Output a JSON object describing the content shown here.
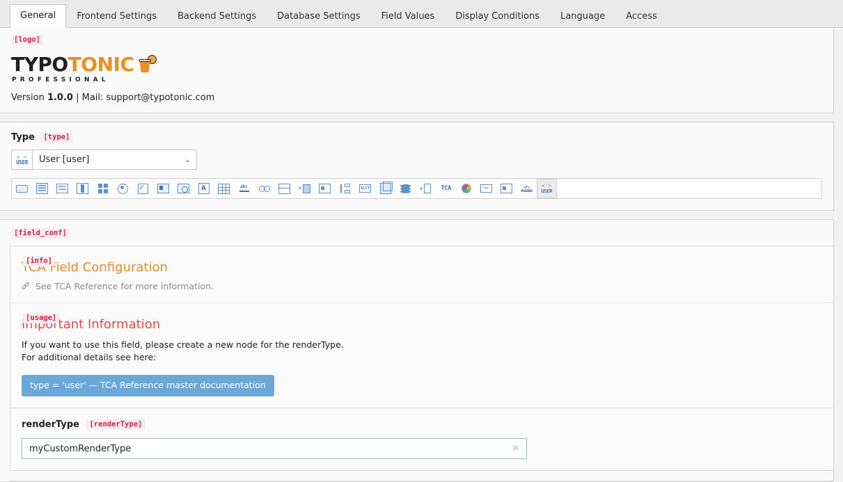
{
  "tabs": [
    {
      "label": "General",
      "active": true
    },
    {
      "label": "Frontend Settings",
      "active": false
    },
    {
      "label": "Backend Settings",
      "active": false
    },
    {
      "label": "Database Settings",
      "active": false
    },
    {
      "label": "Field Values",
      "active": false
    },
    {
      "label": "Display Conditions",
      "active": false
    },
    {
      "label": "Language",
      "active": false
    },
    {
      "label": "Access",
      "active": false
    }
  ],
  "logo_panel": {
    "badge": "[logo]",
    "logo_text_primary": "TYPO",
    "logo_text_accent": "TONIC",
    "logo_subtitle": "PROFESSIONAL",
    "version_prefix": "Version ",
    "version_number": "1.0.0",
    "version_suffix": " | Mail: support@typotonic.com"
  },
  "type_panel": {
    "label": "Type",
    "badge": "[type]",
    "select_value": "User [user]",
    "select_icon_top": "< >",
    "select_icon_bottom": "USER",
    "chevron": "⌄",
    "toolbar_icons": [
      {
        "name": "input-icon",
        "shape": "sh-box",
        "text": "",
        "selected": false
      },
      {
        "name": "text-icon",
        "shape": "sh-frame",
        "text": "",
        "selected": false
      },
      {
        "name": "textarea-icon",
        "shape": "sh-rows",
        "text": "",
        "selected": false
      },
      {
        "name": "split-view-icon",
        "shape": "sh-split",
        "text": "",
        "selected": false
      },
      {
        "name": "grid-icon",
        "shape": "sh-grid4",
        "text": "",
        "selected": false
      },
      {
        "name": "radio-icon",
        "shape": "sh-radio",
        "text": "",
        "selected": false
      },
      {
        "name": "checkbox-icon",
        "shape": "sh-check",
        "text": "",
        "selected": false
      },
      {
        "name": "image-text-icon",
        "shape": "sh-imgtxt",
        "text": "",
        "selected": false
      },
      {
        "name": "datetime-icon",
        "shape": "sh-imgclock",
        "text": "",
        "selected": false
      },
      {
        "name": "letter-a-icon",
        "shape": "sh-letter",
        "text": "A",
        "selected": false
      },
      {
        "name": "table-icon",
        "shape": "sh-table",
        "text": "",
        "selected": false
      },
      {
        "name": "slug-icon",
        "shape": "sh-slug",
        "text": "",
        "selected": false
      },
      {
        "name": "link-icon",
        "shape": "sh-link",
        "text": "",
        "selected": false
      },
      {
        "name": "stack-icon",
        "shape": "sh-stack",
        "text": "",
        "selected": false
      },
      {
        "name": "inline-icon",
        "shape": "sh-inline",
        "text": "",
        "selected": false
      },
      {
        "name": "card-icon",
        "shape": "sh-card",
        "text": "",
        "selected": false
      },
      {
        "name": "tree-icon",
        "shape": "sh-tree",
        "text": "",
        "selected": false
      },
      {
        "name": "select-icon",
        "shape": "sh-select",
        "text": "SLCT",
        "selected": false
      },
      {
        "name": "cube-icon",
        "shape": "sh-cube",
        "text": "",
        "selected": false
      },
      {
        "name": "database-icon",
        "shape": "sh-db",
        "text": "",
        "selected": false
      },
      {
        "name": "file-arrow-icon",
        "shape": "sh-filearrow",
        "text": "",
        "selected": false
      },
      {
        "name": "tca-icon",
        "shape": "sh-tca",
        "text": "TCA",
        "selected": false
      },
      {
        "name": "color-wheel-icon",
        "shape": "sh-wheel",
        "text": "",
        "selected": false
      },
      {
        "name": "code-icon",
        "shape": "sh-select",
        "text": ">>",
        "selected": false
      },
      {
        "name": "panel-icon",
        "shape": "sh-card",
        "text": "",
        "selected": false
      },
      {
        "name": "fluid-icon",
        "shape": "sh-fluid",
        "text": "FLUID",
        "selected": false
      },
      {
        "name": "user-icon",
        "shape": "sh-userico",
        "text": "USER",
        "selected": true
      }
    ]
  },
  "field_conf": {
    "badge": "[field_conf]",
    "info_section": {
      "badge": "[info]",
      "title": "TCA Field Configuration",
      "reference_text": "See TCA Reference for more information."
    },
    "usage_section": {
      "badge": "[usage]",
      "title": "Important Information",
      "line1": "If you want to use this field, please create a new node for the renderType.",
      "line2": "For additional details see here:",
      "doc_button": "type = 'user' — TCA Reference master documentation"
    },
    "render_type_section": {
      "label": "renderType",
      "badge": "[renderType]",
      "value": "myCustomRenderType",
      "clear": "×"
    }
  },
  "colors": {
    "accent_orange": "#e8911f",
    "badge_text": "#c7254e",
    "badge_bg": "#fbecf0",
    "info_title": "#e08b2e",
    "usage_title": "#e04a4a",
    "doc_button_bg": "#6ba7d8",
    "icon_blue": "#5b8fd6"
  }
}
